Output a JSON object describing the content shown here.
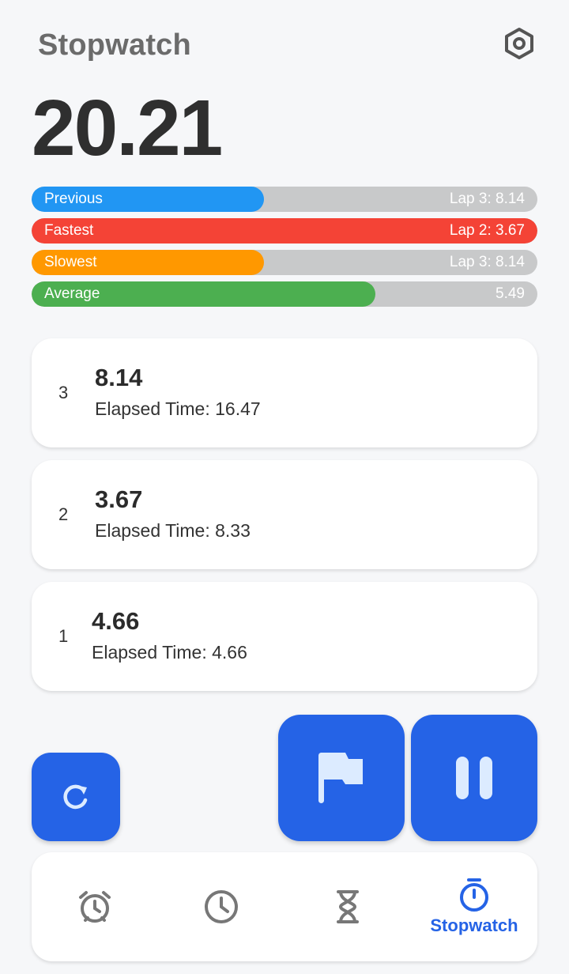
{
  "header": {
    "title": "Stopwatch"
  },
  "timer": {
    "display": "20.21"
  },
  "stats": [
    {
      "label": "Previous",
      "value": "Lap 3: 8.14",
      "color": "#2196f3",
      "fill_fraction": 0.46
    },
    {
      "label": "Fastest",
      "value": "Lap 2: 3.67",
      "color": "#f44336",
      "fill_fraction": 1.0
    },
    {
      "label": "Slowest",
      "value": "Lap 3: 8.14",
      "color": "#ff9800",
      "fill_fraction": 0.46
    },
    {
      "label": "Average",
      "value": "5.49",
      "color": "#4caf50",
      "fill_fraction": 0.68
    }
  ],
  "laps": [
    {
      "number": "3",
      "time": "8.14",
      "elapsed": "Elapsed Time: 16.47"
    },
    {
      "number": "2",
      "time": "3.67",
      "elapsed": "Elapsed Time: 8.33"
    },
    {
      "number": "1",
      "time": "4.66",
      "elapsed": "Elapsed Time: 4.66"
    }
  ],
  "controls": {
    "reset_icon": "refresh-icon",
    "lap_icon": "flag-icon",
    "pause_icon": "pause-icon"
  },
  "nav": {
    "items": [
      {
        "icon": "alarm-icon",
        "label": ""
      },
      {
        "icon": "clock-icon",
        "label": ""
      },
      {
        "icon": "hourglass-icon",
        "label": ""
      },
      {
        "icon": "stopwatch-icon",
        "label": "Stopwatch"
      }
    ]
  },
  "colors": {
    "accent": "#2563e6",
    "track": "#c8c9ca",
    "background": "#f6f7f9"
  }
}
